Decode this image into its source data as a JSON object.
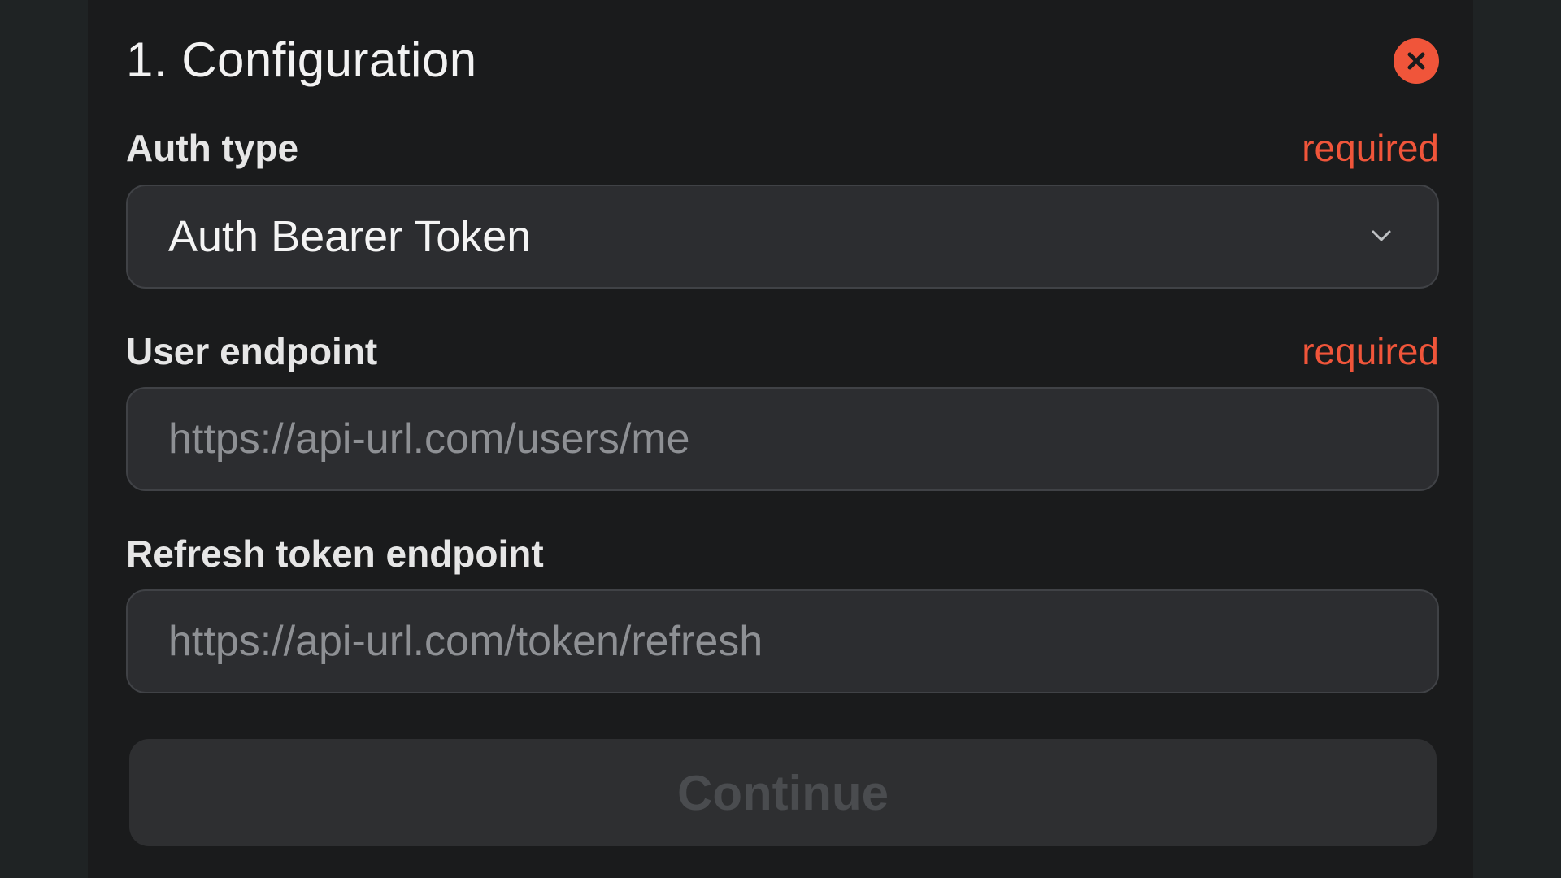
{
  "section": {
    "title": "1. Configuration",
    "close_icon": "close-icon",
    "accent_color": "#f0553a"
  },
  "fields": {
    "auth_type": {
      "label": "Auth type",
      "required_text": "required",
      "value": "Auth Bearer Token"
    },
    "user_endpoint": {
      "label": "User endpoint",
      "required_text": "required",
      "value": "",
      "placeholder": "https://api-url.com/users/me"
    },
    "refresh_endpoint": {
      "label": "Refresh token endpoint",
      "value": "",
      "placeholder": "https://api-url.com/token/refresh"
    }
  },
  "actions": {
    "continue_label": "Continue",
    "continue_disabled": true
  }
}
